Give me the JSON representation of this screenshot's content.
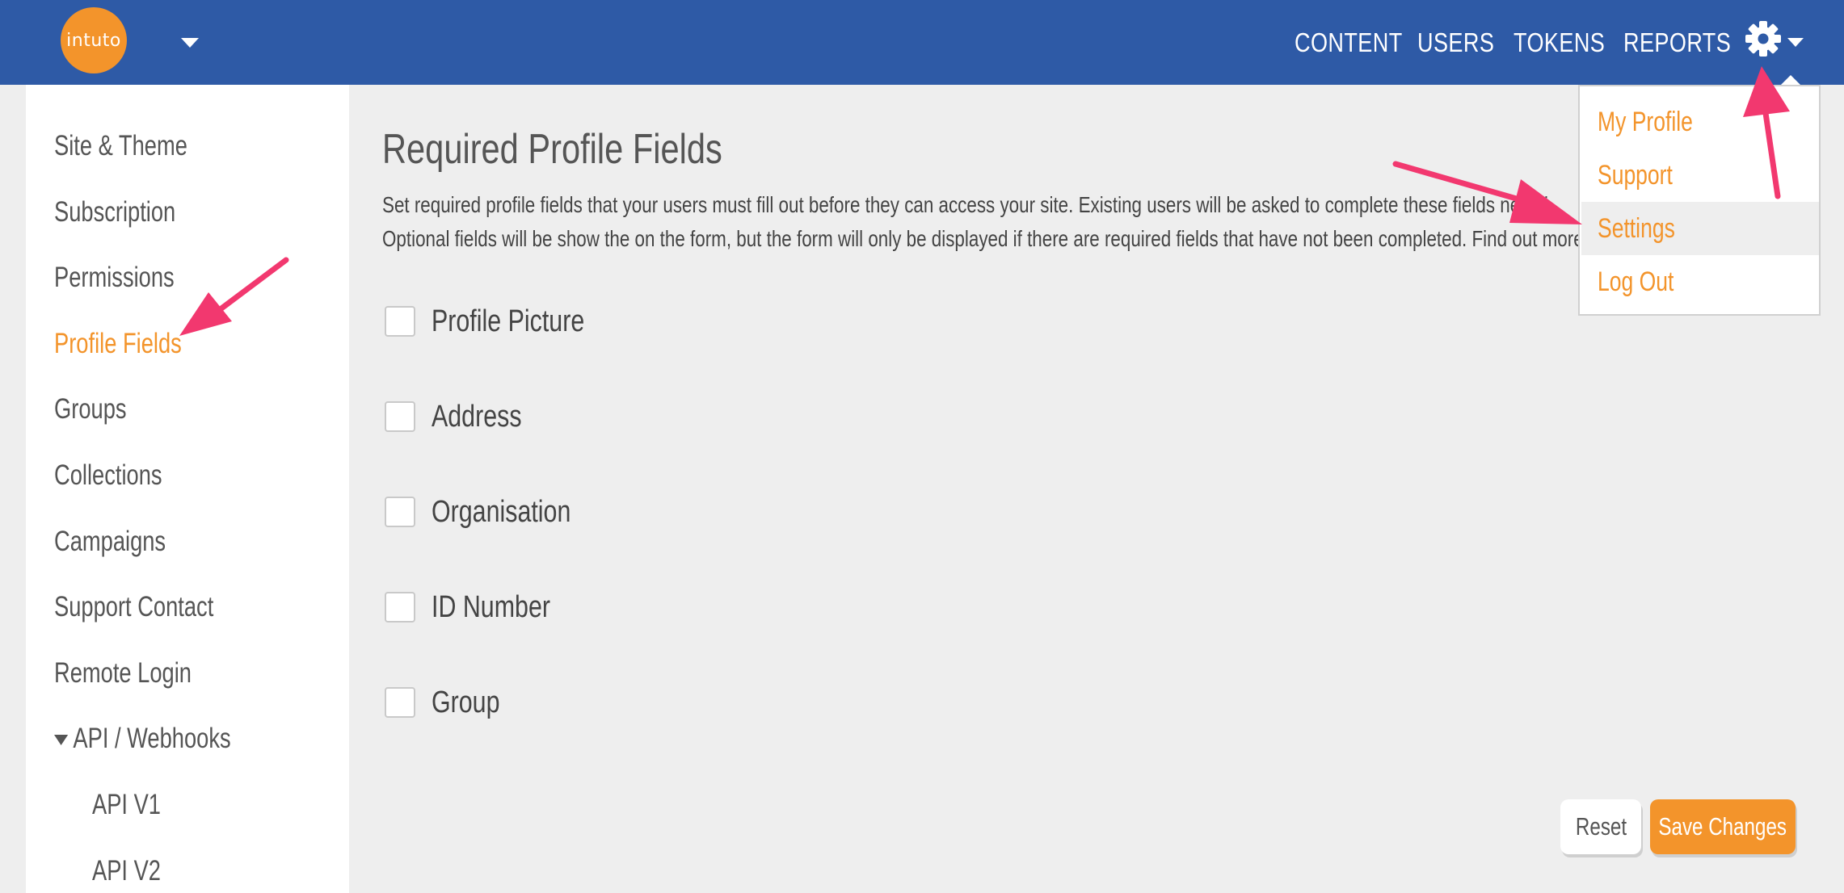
{
  "brand": {
    "logo_text": "intuto"
  },
  "nav": {
    "content": "CONTENT",
    "users": "USERS",
    "tokens": "TOKENS",
    "reports": "REPORTS"
  },
  "sidebar": {
    "items": [
      {
        "label": "Site & Theme"
      },
      {
        "label": "Subscription"
      },
      {
        "label": "Permissions"
      },
      {
        "label": "Profile Fields"
      },
      {
        "label": "Groups"
      },
      {
        "label": "Collections"
      },
      {
        "label": "Campaigns"
      },
      {
        "label": "Support Contact"
      },
      {
        "label": "Remote Login"
      },
      {
        "label": "API / Webhooks"
      },
      {
        "label": "API V1"
      },
      {
        "label": "API V2"
      }
    ],
    "active": "Profile Fields"
  },
  "main": {
    "title": "Required Profile Fields",
    "description_line1": "Set required profile fields that your users must fill out before they can access your site. Existing users will be asked to complete these fields next ti",
    "description_line2": "Optional fields will be show the on the form, but the form will only be displayed if there are required fields that have not been completed. Find out more about",
    "fields": [
      {
        "label": "Profile Picture",
        "checked": false
      },
      {
        "label": "Address",
        "checked": false
      },
      {
        "label": "Organisation",
        "checked": false
      },
      {
        "label": "ID Number",
        "checked": false
      },
      {
        "label": "Group",
        "checked": false
      }
    ]
  },
  "buttons": {
    "reset": "Reset",
    "save": "Save Changes"
  },
  "dropdown": {
    "items": [
      {
        "label": "My Profile"
      },
      {
        "label": "Support"
      },
      {
        "label": "Settings"
      },
      {
        "label": "Log Out"
      }
    ],
    "highlighted": "Settings"
  },
  "colors": {
    "topbar": "#2e5aa6",
    "accent": "#f3942b",
    "background": "#eeeeee",
    "annotation_arrow": "#f2386f"
  },
  "icons": {
    "settings": "gear-icon",
    "menu_caret": "caret-down-icon"
  }
}
